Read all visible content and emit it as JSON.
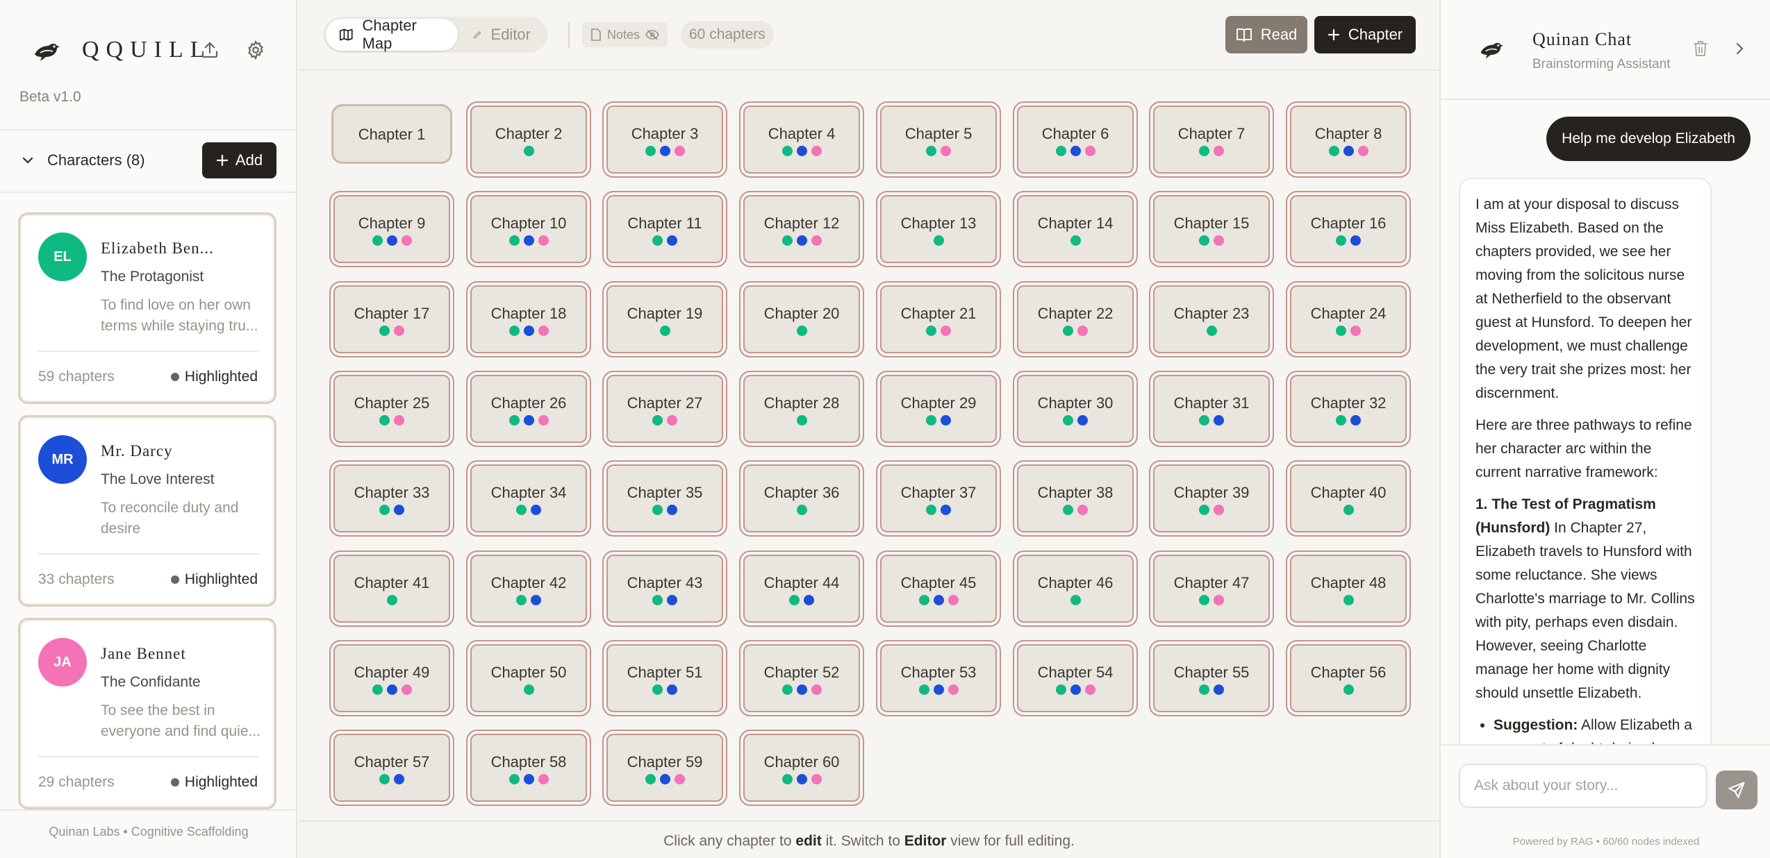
{
  "app": {
    "brand": "QQUILL",
    "version": "Beta v1.0",
    "footer": "Quinan Labs • Cognitive Scaffolding"
  },
  "characters": {
    "title": "Characters (8)",
    "add_label": "Add",
    "items": [
      {
        "initials": "EL",
        "name": "Elizabeth Ben...",
        "role": "The Protagonist",
        "goal": "To find love on her own terms while staying tru...",
        "chapters": "59 chapters",
        "status": "Highlighted",
        "color": "#10b981"
      },
      {
        "initials": "MR",
        "name": "Mr. Darcy",
        "role": "The Love Interest",
        "goal": "To reconcile duty and desire",
        "chapters": "33 chapters",
        "status": "Highlighted",
        "color": "#1d4ed8"
      },
      {
        "initials": "JA",
        "name": "Jane Bennet",
        "role": "The Confidante",
        "goal": "To see the best in everyone and find quie...",
        "chapters": "29 chapters",
        "status": "Highlighted",
        "color": "#f472b6"
      }
    ]
  },
  "toolbar": {
    "tab_map": "Chapter Map",
    "tab_editor": "Editor",
    "notes": "Notes",
    "count": "60 chapters",
    "read": "Read",
    "chapter": "Chapter"
  },
  "colors": {
    "green": "#10b981",
    "blue": "#1d4ed8",
    "pink": "#f472b6"
  },
  "chapters": [
    {
      "label": "Chapter 1",
      "chars": []
    },
    {
      "label": "Chapter 2",
      "chars": [
        "green"
      ]
    },
    {
      "label": "Chapter 3",
      "chars": [
        "green",
        "blue",
        "pink"
      ]
    },
    {
      "label": "Chapter 4",
      "chars": [
        "green",
        "blue",
        "pink"
      ]
    },
    {
      "label": "Chapter 5",
      "chars": [
        "green",
        "pink"
      ]
    },
    {
      "label": "Chapter 6",
      "chars": [
        "green",
        "blue",
        "pink"
      ]
    },
    {
      "label": "Chapter 7",
      "chars": [
        "green",
        "pink"
      ]
    },
    {
      "label": "Chapter 8",
      "chars": [
        "green",
        "blue",
        "pink"
      ]
    },
    {
      "label": "Chapter 9",
      "chars": [
        "green",
        "blue",
        "pink"
      ]
    },
    {
      "label": "Chapter 10",
      "chars": [
        "green",
        "blue",
        "pink"
      ]
    },
    {
      "label": "Chapter 11",
      "chars": [
        "green",
        "blue"
      ]
    },
    {
      "label": "Chapter 12",
      "chars": [
        "green",
        "blue",
        "pink"
      ]
    },
    {
      "label": "Chapter 13",
      "chars": [
        "green"
      ]
    },
    {
      "label": "Chapter 14",
      "chars": [
        "green"
      ]
    },
    {
      "label": "Chapter 15",
      "chars": [
        "green",
        "pink"
      ]
    },
    {
      "label": "Chapter 16",
      "chars": [
        "green",
        "blue"
      ]
    },
    {
      "label": "Chapter 17",
      "chars": [
        "green",
        "pink"
      ]
    },
    {
      "label": "Chapter 18",
      "chars": [
        "green",
        "blue",
        "pink"
      ]
    },
    {
      "label": "Chapter 19",
      "chars": [
        "green"
      ]
    },
    {
      "label": "Chapter 20",
      "chars": [
        "green"
      ]
    },
    {
      "label": "Chapter 21",
      "chars": [
        "green",
        "pink"
      ]
    },
    {
      "label": "Chapter 22",
      "chars": [
        "green",
        "pink"
      ]
    },
    {
      "label": "Chapter 23",
      "chars": [
        "green"
      ]
    },
    {
      "label": "Chapter 24",
      "chars": [
        "green",
        "pink"
      ]
    },
    {
      "label": "Chapter 25",
      "chars": [
        "green",
        "pink"
      ]
    },
    {
      "label": "Chapter 26",
      "chars": [
        "green",
        "blue",
        "pink"
      ]
    },
    {
      "label": "Chapter 27",
      "chars": [
        "green",
        "pink"
      ]
    },
    {
      "label": "Chapter 28",
      "chars": [
        "green"
      ]
    },
    {
      "label": "Chapter 29",
      "chars": [
        "green",
        "blue"
      ]
    },
    {
      "label": "Chapter 30",
      "chars": [
        "green",
        "blue"
      ]
    },
    {
      "label": "Chapter 31",
      "chars": [
        "green",
        "blue"
      ]
    },
    {
      "label": "Chapter 32",
      "chars": [
        "green",
        "blue"
      ]
    },
    {
      "label": "Chapter 33",
      "chars": [
        "green",
        "blue"
      ]
    },
    {
      "label": "Chapter 34",
      "chars": [
        "green",
        "blue"
      ]
    },
    {
      "label": "Chapter 35",
      "chars": [
        "green",
        "blue"
      ]
    },
    {
      "label": "Chapter 36",
      "chars": [
        "green"
      ]
    },
    {
      "label": "Chapter 37",
      "chars": [
        "green",
        "blue"
      ]
    },
    {
      "label": "Chapter 38",
      "chars": [
        "green",
        "pink"
      ]
    },
    {
      "label": "Chapter 39",
      "chars": [
        "green",
        "pink"
      ]
    },
    {
      "label": "Chapter 40",
      "chars": [
        "green"
      ]
    },
    {
      "label": "Chapter 41",
      "chars": [
        "green"
      ]
    },
    {
      "label": "Chapter 42",
      "chars": [
        "green",
        "blue"
      ]
    },
    {
      "label": "Chapter 43",
      "chars": [
        "green",
        "blue"
      ]
    },
    {
      "label": "Chapter 44",
      "chars": [
        "green",
        "blue"
      ]
    },
    {
      "label": "Chapter 45",
      "chars": [
        "green",
        "blue",
        "pink"
      ]
    },
    {
      "label": "Chapter 46",
      "chars": [
        "green"
      ]
    },
    {
      "label": "Chapter 47",
      "chars": [
        "green",
        "pink"
      ]
    },
    {
      "label": "Chapter 48",
      "chars": [
        "green"
      ]
    },
    {
      "label": "Chapter 49",
      "chars": [
        "green",
        "blue",
        "pink"
      ]
    },
    {
      "label": "Chapter 50",
      "chars": [
        "green"
      ]
    },
    {
      "label": "Chapter 51",
      "chars": [
        "green",
        "blue"
      ]
    },
    {
      "label": "Chapter 52",
      "chars": [
        "green",
        "blue",
        "pink"
      ]
    },
    {
      "label": "Chapter 53",
      "chars": [
        "green",
        "blue",
        "pink"
      ]
    },
    {
      "label": "Chapter 54",
      "chars": [
        "green",
        "blue",
        "pink"
      ]
    },
    {
      "label": "Chapter 55",
      "chars": [
        "green",
        "blue"
      ]
    },
    {
      "label": "Chapter 56",
      "chars": [
        "green"
      ]
    },
    {
      "label": "Chapter 57",
      "chars": [
        "green",
        "blue"
      ]
    },
    {
      "label": "Chapter 58",
      "chars": [
        "green",
        "blue",
        "pink"
      ]
    },
    {
      "label": "Chapter 59",
      "chars": [
        "green",
        "blue",
        "pink"
      ]
    },
    {
      "label": "Chapter 60",
      "chars": [
        "green",
        "blue",
        "pink"
      ]
    }
  ],
  "hint": {
    "pre": "Click any chapter to ",
    "edit": "edit",
    "mid": " it. Switch to ",
    "editor": "Editor",
    "post": " view for full editing."
  },
  "chat": {
    "title": "Quinan Chat",
    "subtitle": "Brainstorming Assistant",
    "user_message": "Help me develop Elizabeth",
    "bot_p1": "I am at your disposal to discuss Miss Elizabeth. Based on the chapters provided, we see her moving from the solicitous nurse at Netherfield to the observant guest at Hunsford. To deepen her development, we must challenge the very trait she prizes most: her discernment.",
    "bot_p2": "Here are three pathways to refine her character arc within the current narrative framework:",
    "bot_p3_bold": "1. The Test of Pragmatism (Hunsford)",
    "bot_p3": " In Chapter 27, Elizabeth travels to Hunsford with some reluctance. She views Charlotte's marriage to Mr. Collins with pity, perhaps even disdain. However, seeing Charlotte manage her home with dignity should unsettle Elizabeth.",
    "bot_li_bold": "Suggestion:",
    "bot_li": " Allow Elizabeth a moment of doubt during her stay",
    "input_placeholder": "Ask about your story...",
    "footer": "Powered by RAG • 60/60 nodes indexed"
  }
}
